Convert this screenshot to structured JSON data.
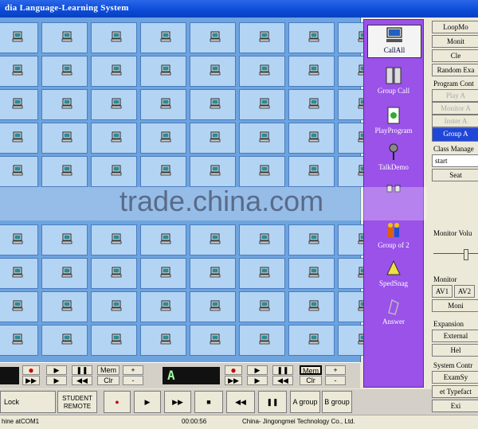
{
  "window": {
    "title": "dia Language-Learning System"
  },
  "colors": {
    "title_bar": "#0a4bd8",
    "seat_grid": "#6ea4de",
    "tool_panel": "#9a52e8",
    "selected_group": "#2046d8"
  },
  "seat_icon": "computer-icon",
  "left_controls": {
    "lcd_value": "A",
    "mem_label": "Mem",
    "plus_label": "+",
    "clr_label": "Clr",
    "minus_label": "-",
    "record_glyph": "●",
    "play_glyph": "▶",
    "pause_glyph": "❚❚",
    "rewind_glyph": "◀◀",
    "forward_glyph": "▶▶"
  },
  "bottom_bar": {
    "lock_label": "Lock",
    "student_remote_label": "STUDENT REMOTE",
    "a_group_label": "A group",
    "b_group_label": "B group",
    "record_glyph": "●",
    "play_glyph": "▶",
    "forward_glyph": "▶▶",
    "stop_glyph": "■",
    "rewind_glyph": "◀◀",
    "pause_glyph": "❚❚"
  },
  "status_bar": {
    "left": "hine atCOM1",
    "time": "00:00:56",
    "company": "China- Jingongmei Technology Co., Ltd."
  },
  "tools": [
    {
      "label": "CallAll",
      "icon": "call-all-icon",
      "selected": true
    },
    {
      "label": "Group Call",
      "icon": "group-call-icon",
      "selected": false
    },
    {
      "label": "PlayProgram",
      "icon": "play-program-icon",
      "selected": false
    },
    {
      "label": "TalkDemo",
      "icon": "microphone-icon",
      "selected": false
    },
    {
      "label": "",
      "icon": "pair-icon",
      "selected": false
    },
    {
      "label": "Group of 2",
      "icon": "group-of-two-icon",
      "selected": false
    },
    {
      "label": "SpedSnag",
      "icon": "speed-snag-icon",
      "selected": false
    },
    {
      "label": "Answer",
      "icon": "answer-icon",
      "selected": false
    }
  ],
  "right_panel": {
    "loop_button": "LoopMo",
    "monitor_button": "Monit",
    "class_button": "Cle",
    "random_exam_button": "Random Exa",
    "program_control_label": "Program Cont",
    "play_a": "Play A",
    "monitor_a": "Monitor A",
    "insert_a": "Inster A",
    "group_a": "Group A",
    "class_manage_label": "Class Manage",
    "class_input_value": "start",
    "seat_button": "Seat",
    "monitor_volume_label": "Monitor Volu",
    "monitor_label": "Monitor",
    "av1": "AV1",
    "av2": "AV2",
    "monitor2_button": "Moni",
    "expansion_label": "Expansion",
    "external_button": "External",
    "help_button": "Hel",
    "system_control_label": "System Contr",
    "examsys_button": "ExamSy",
    "typefact_button": "et Typefact",
    "exit_button": "Exi"
  },
  "watermark": "trade.china.com"
}
